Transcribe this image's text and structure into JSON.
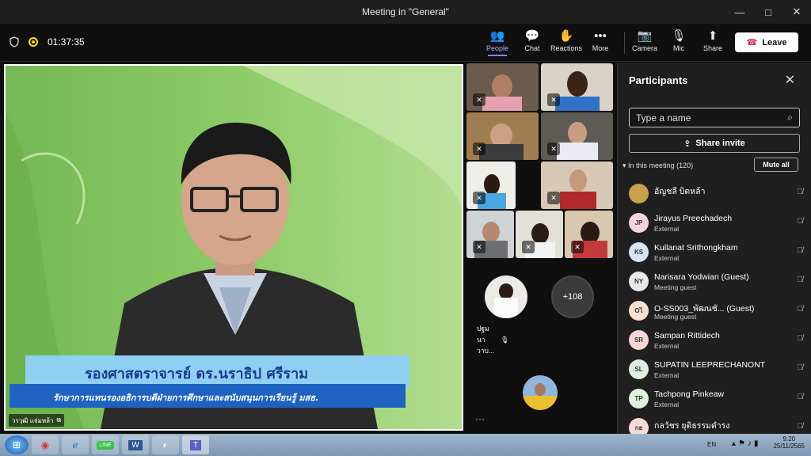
{
  "window": {
    "title": "Meeting in \"General\"",
    "controls": [
      "—",
      "□",
      "✕"
    ]
  },
  "toolbar": {
    "timer": "01:37:35",
    "buttons": {
      "people": "People",
      "chat": "Chat",
      "reactions": "Reactions",
      "more": "More",
      "camera": "Camera",
      "mic": "Mic",
      "share": "Share"
    },
    "leave": "Leave"
  },
  "main_video": {
    "caption_title": "รองศาสตราจารย์ ดร.นราธิป ศรีราม",
    "caption_subtitle": "รักษาการแทนรองอธิการบดีฝ่ายการศึกษาและสนับสนุนการเรียนรู้ มสธ.",
    "presenter_name": "วรวุฒิ แจ่มหล้า"
  },
  "gallery": {
    "named_tile": "ปฐม นาวาบ...",
    "overflow_count": "+108",
    "more_dots": "···"
  },
  "participants": {
    "title": "Participants",
    "search_placeholder": "Type a name",
    "share_invite": "Share invite",
    "in_meeting": "In this meeting (120)",
    "mute_all": "Mute all",
    "list": [
      {
        "initials": "",
        "name": "อัญชลี บิดหล้า",
        "sub": "",
        "color": "#c8a24a"
      },
      {
        "initials": "JP",
        "name": "Jirayus Preechadech",
        "sub": "External",
        "color": "#f4d4da"
      },
      {
        "initials": "KS",
        "name": "Kullanat Srithongkham",
        "sub": "External",
        "color": "#d6e4f5"
      },
      {
        "initials": "NY",
        "name": "Narisara Yodwian (Guest)",
        "sub": "Meeting guest",
        "color": "#e8e8e8"
      },
      {
        "initials": "Oไ",
        "name": "O-SS003_พัฒนชั...  (Guest)",
        "sub": "Meeting guest",
        "color": "#f7e0cf"
      },
      {
        "initials": "SR",
        "name": "Sampan Rittidech",
        "sub": "External",
        "color": "#f6d6d6"
      },
      {
        "initials": "SL",
        "name": "SUPATIN LEEPRECHANONT",
        "sub": "External",
        "color": "#dbeee0"
      },
      {
        "initials": "TP",
        "name": "Tachpong Pinkeaw",
        "sub": "External",
        "color": "#dff0dc"
      },
      {
        "initials": "กย",
        "name": "กลวัชร ยุติธรรมดำรง",
        "sub": "",
        "color": "#f6d9d9"
      }
    ]
  },
  "taskbar": {
    "lang": "EN",
    "time": "9:20",
    "date": "25/11/2565"
  }
}
